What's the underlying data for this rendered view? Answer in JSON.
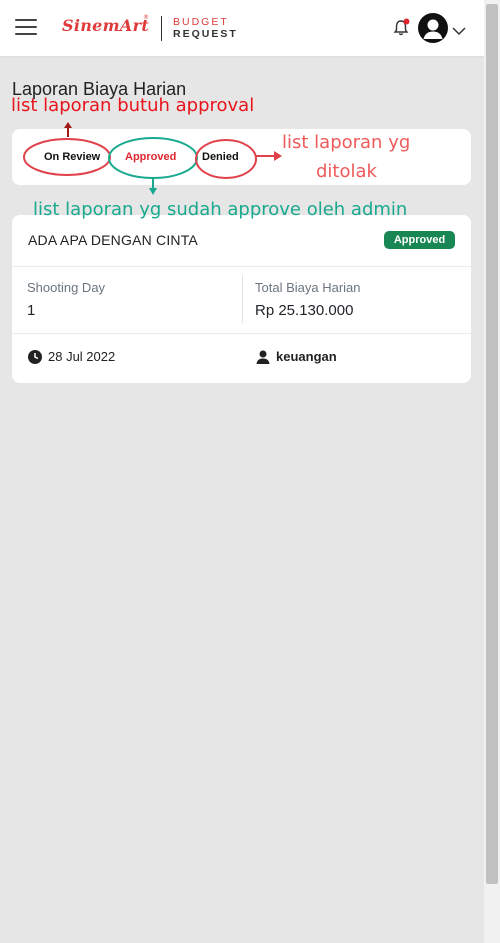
{
  "header": {
    "logo_script": "SinemArt",
    "logo_sup": "®",
    "logo_line1": "BUDGET",
    "logo_line2": "REQUEST",
    "icons": [
      "menu-icon",
      "bell-icon",
      "user-avatar-icon",
      "chevron-down-icon"
    ],
    "notification_dot_color": "#e0262e"
  },
  "page": {
    "title": "Laporan Biaya Harian"
  },
  "tabs": [
    {
      "label": "On Review",
      "active": false
    },
    {
      "label": "Approved",
      "active": true
    },
    {
      "label": "Denied",
      "active": false
    }
  ],
  "report": {
    "title": "ADA APA DENGAN CINTA",
    "status": "Approved",
    "shooting_day_label": "Shooting Day",
    "shooting_day_value": "1",
    "total_label": "Total Biaya Harian",
    "total_value": "Rp 25.130.000",
    "date": "28 Jul 2022",
    "user": "keuangan"
  },
  "annotations": {
    "review": "list laporan butuh approval",
    "denied_line1": "list laporan yg",
    "denied_line2": "ditolak",
    "approved": "list laporan yg sudah approve oleh admin"
  },
  "colors": {
    "brand_red": "#e03a3a",
    "active_tab": "#e0262e",
    "badge_green": "#198754",
    "annotation_red": "#e8141c",
    "annotation_salmon": "#ef5a5a",
    "annotation_teal": "#19a98f"
  }
}
